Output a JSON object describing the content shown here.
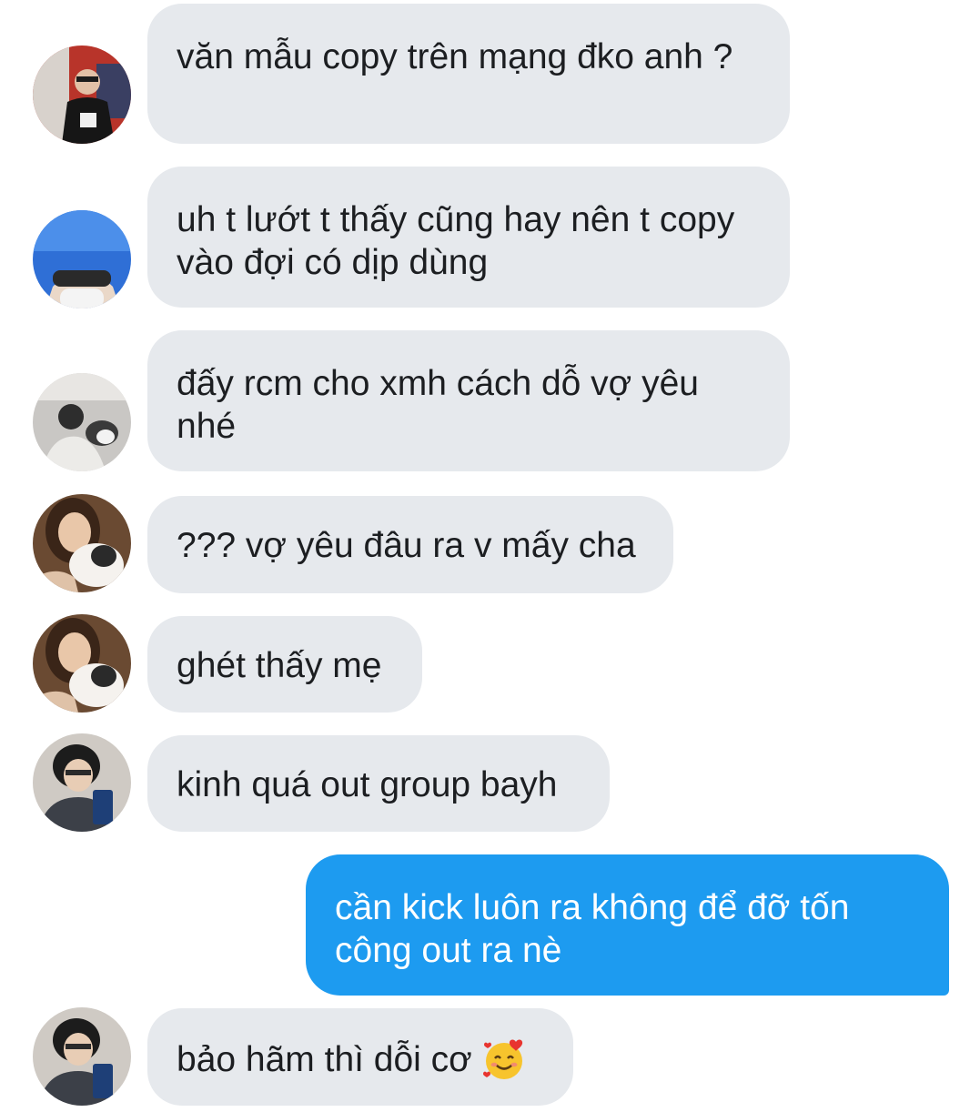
{
  "messages": [
    {
      "direction": "incoming",
      "avatar": "avatar-red-shop",
      "text": "văn mẫu copy trên mạng đko anh ?"
    },
    {
      "direction": "incoming",
      "avatar": "avatar-sky-mask",
      "text": "uh t lướt t thấy cũng hay nên t copy vào đợi có dịp dùng"
    },
    {
      "direction": "incoming",
      "avatar": "avatar-cat-bed",
      "text": "đấy rcm cho xmh cách dỗ vợ yêu nhé"
    },
    {
      "direction": "incoming",
      "avatar": "avatar-girl-cat",
      "text": "??? vợ yêu đâu ra v mấy cha"
    },
    {
      "direction": "incoming",
      "avatar": "avatar-girl-cat",
      "text": "ghét thấy mẹ"
    },
    {
      "direction": "incoming",
      "avatar": "avatar-selfie-phone",
      "text": "kinh quá out group bayh"
    },
    {
      "direction": "outgoing",
      "text": "cần kick luôn ra không để đỡ tốn công out ra nè"
    },
    {
      "direction": "incoming",
      "avatar": "avatar-selfie-phone",
      "text": "bảo hãm thì dỗi cơ",
      "emoji": "smiling-face-with-hearts-icon"
    }
  ],
  "colors": {
    "incoming_bubble": "#e6e9ed",
    "outgoing_bubble": "#1d9bf0",
    "incoming_text": "#1c1e21",
    "outgoing_text": "#ffffff"
  }
}
